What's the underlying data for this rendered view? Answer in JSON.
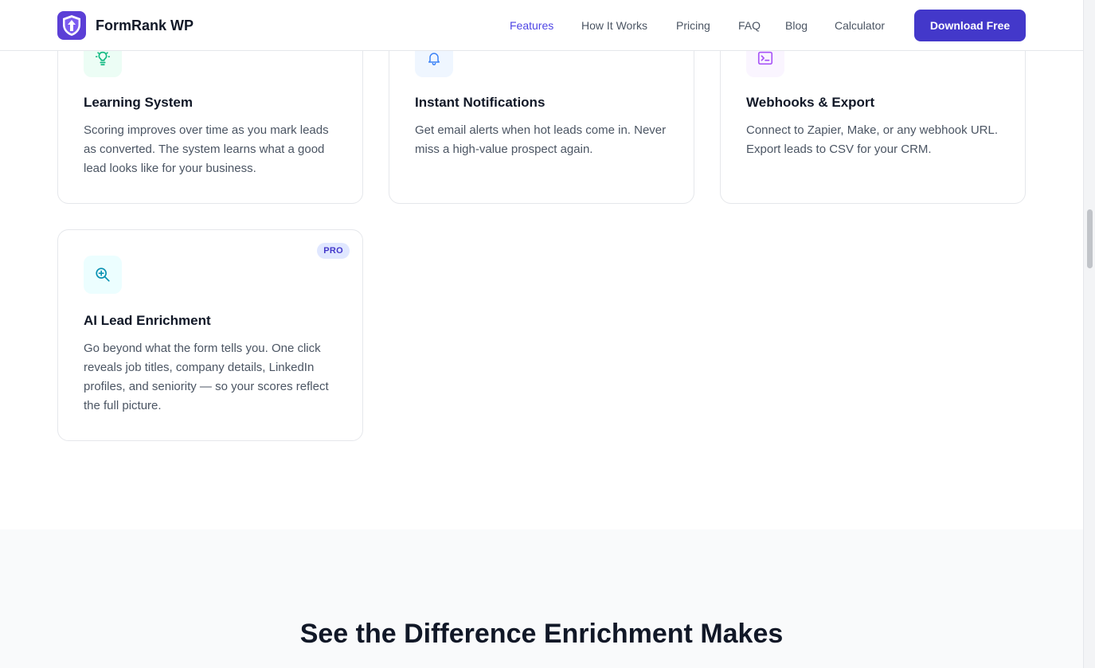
{
  "header": {
    "brand_name": "FormRank WP",
    "nav": [
      {
        "label": "Features",
        "active": true
      },
      {
        "label": "How It Works"
      },
      {
        "label": "Pricing"
      },
      {
        "label": "FAQ"
      },
      {
        "label": "Blog"
      },
      {
        "label": "Calculator"
      }
    ],
    "cta_label": "Download Free"
  },
  "features": [
    {
      "icon": "lightbulb-icon",
      "title": "Learning System",
      "description": "Scoring improves over time as you mark leads as converted. The system learns what a good lead looks like for your business."
    },
    {
      "icon": "bell-icon",
      "title": "Instant Notifications",
      "description": "Get email alerts when hot leads come in. Never miss a high-value prospect again."
    },
    {
      "icon": "terminal-icon",
      "title": "Webhooks & Export",
      "description": "Connect to Zapier, Make, or any webhook URL. Export leads to CSV for your CRM."
    },
    {
      "icon": "search-plus-icon",
      "title": "AI Lead Enrichment",
      "description": "Go beyond what the form tells you. One click reveals job titles, company details, LinkedIn profiles, and seniority — so your scores reflect the full picture.",
      "badge": "PRO"
    }
  ],
  "comparison_section": {
    "heading": "See the Difference Enrichment Makes"
  },
  "colors": {
    "accent": "#4338ca",
    "nav_active": "#4f46e5",
    "green_icon": "#10b981",
    "blue_icon": "#3b82f6",
    "purple_icon": "#a855f7",
    "cyan_icon": "#0891b2"
  }
}
